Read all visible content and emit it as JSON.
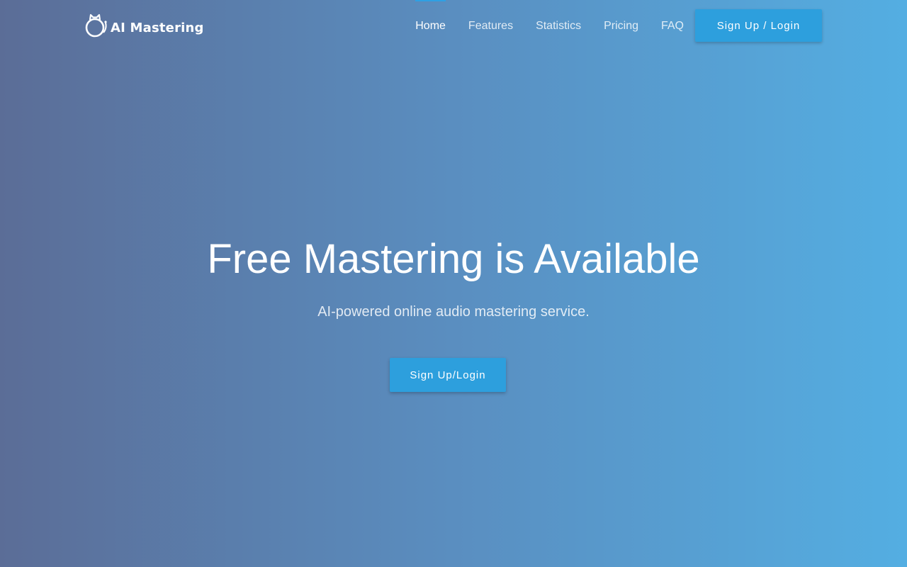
{
  "brand": {
    "name": "AI Mastering",
    "logo_icon": "cat-ring-logo-icon"
  },
  "nav": {
    "items": [
      {
        "label": "Home",
        "active": true
      },
      {
        "label": "Features",
        "active": false
      },
      {
        "label": "Statistics",
        "active": false
      },
      {
        "label": "Pricing",
        "active": false
      },
      {
        "label": "FAQ",
        "active": false
      }
    ],
    "cta_label": "Sign Up / Login"
  },
  "hero": {
    "title": "Free Mastering is Available",
    "subtitle": "AI-powered online audio mastering service.",
    "cta_label": "Sign Up/Login"
  },
  "colors": {
    "accent": "#2d9fdd",
    "gradient_start": "#5b6d97",
    "gradient_end": "#54aee2"
  }
}
